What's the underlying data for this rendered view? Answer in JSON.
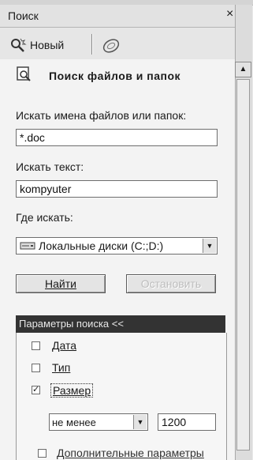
{
  "window": {
    "title": "Поиск",
    "close_glyph": "×"
  },
  "toolbar": {
    "new_label": "Новый"
  },
  "header": {
    "title": "Поиск файлов и папок"
  },
  "search": {
    "names_label": "Искать имена файлов или папок:",
    "names_value": "*.doc",
    "text_label": "Искать текст:",
    "text_value": "kompyuter",
    "where_label": "Где искать:",
    "where_value": "Локальные диски (C:;D:)"
  },
  "buttons": {
    "find_label": "Найти",
    "stop_label": "Остановить"
  },
  "params": {
    "header": "Параметры поиска <<",
    "date_label": "Дата",
    "date_checked": false,
    "type_label": "Тип",
    "type_checked": false,
    "size_label": "Размер",
    "size_checked": true,
    "size_mode": "не менее",
    "size_value": "1200",
    "advanced_label": "Дополнительные параметры"
  }
}
